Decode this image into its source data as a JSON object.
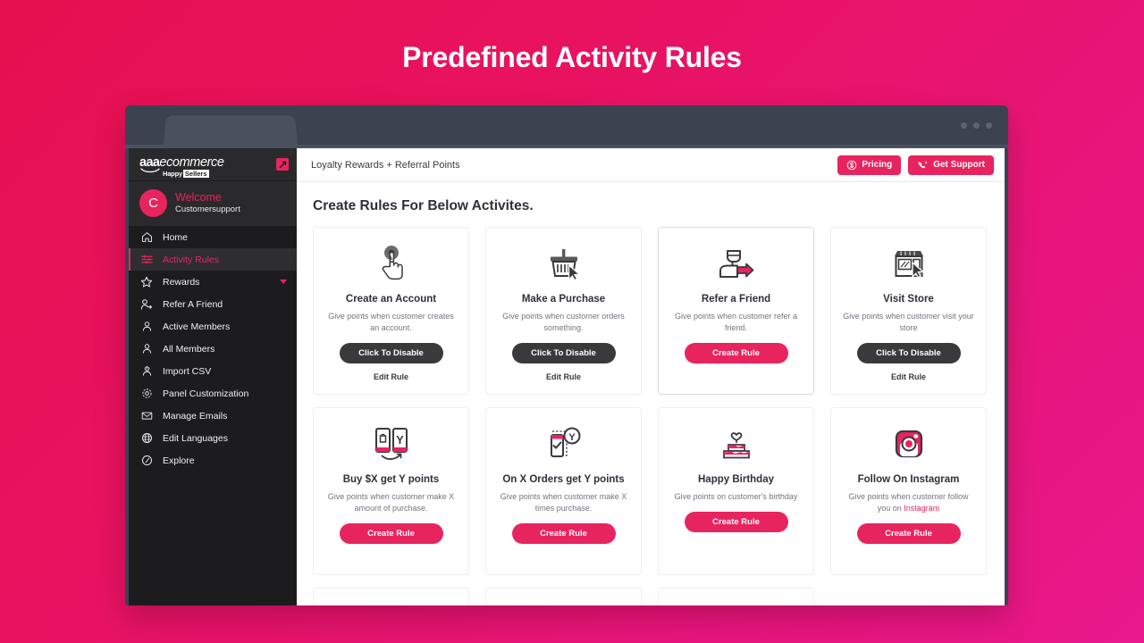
{
  "page": {
    "title": "Predefined Activity Rules",
    "background_start": "#e6104f",
    "background_end": "#e9188c",
    "accent": "#e8245f"
  },
  "sidebar": {
    "brand": {
      "aaa": "aaa",
      "ecommerce": "ecommerce",
      "happy": "Happy",
      "sellers": "Sellers",
      "collapse_icon": "expand-arrow-icon"
    },
    "welcome": {
      "avatar_letter": "C",
      "title": "Welcome",
      "username": "Customersupport"
    },
    "items": [
      {
        "label": "Home",
        "icon": "home-icon",
        "active": false,
        "caret": false
      },
      {
        "label": "Activity Rules",
        "icon": "sliders-icon",
        "active": true,
        "caret": false
      },
      {
        "label": "Rewards",
        "icon": "star-icon",
        "active": false,
        "caret": true
      },
      {
        "label": "Refer A Friend",
        "icon": "user-arrow-icon",
        "active": false,
        "caret": false
      },
      {
        "label": "Active Members",
        "icon": "user-icon",
        "active": false,
        "caret": false
      },
      {
        "label": "All Members",
        "icon": "user-icon",
        "active": false,
        "caret": false
      },
      {
        "label": "Import CSV",
        "icon": "user-import-icon",
        "active": false,
        "caret": false
      },
      {
        "label": "Panel Customization",
        "icon": "gear-icon",
        "active": false,
        "caret": false
      },
      {
        "label": "Manage Emails",
        "icon": "envelope-icon",
        "active": false,
        "caret": false
      },
      {
        "label": "Edit Languages",
        "icon": "globe-icon",
        "active": false,
        "caret": false
      },
      {
        "label": "Explore",
        "icon": "compass-icon",
        "active": false,
        "caret": false
      }
    ]
  },
  "topbar": {
    "title": "Loyalty Rewards + Referral Points",
    "pricing_label": "Pricing",
    "pricing_icon": "dollar-circle-icon",
    "support_label": "Get Support",
    "support_icon": "phone-ring-icon"
  },
  "main": {
    "heading": "Create Rules For Below Activites.",
    "cards": [
      {
        "title": "Create an Account",
        "description": "Give points when customer creates an account.",
        "button_label": "Click To Disable",
        "button_style": "dark",
        "edit_label": "Edit Rule",
        "icon": "click-hand-icon",
        "hovered": false
      },
      {
        "title": "Make a Purchase",
        "description": "Give points when customer orders something.",
        "button_label": "Click To Disable",
        "button_style": "dark",
        "edit_label": "Edit Rule",
        "icon": "shopping-basket-cursor-icon",
        "hovered": false
      },
      {
        "title": "Refer a Friend",
        "description": "Give points when customer refer a friend.",
        "button_label": "Create Rule",
        "button_style": "pink",
        "edit_label": "",
        "icon": "person-arrow-icon",
        "hovered": true
      },
      {
        "title": "Visit Store",
        "description": "Give points when customer visit your store",
        "button_label": "Click To Disable",
        "button_style": "dark",
        "edit_label": "Edit Rule",
        "icon": "storefront-cursor-icon",
        "hovered": false
      },
      {
        "title": "Buy $X get Y points",
        "description": "Give points when customer make X amount of purchase.",
        "button_label": "Create Rule",
        "button_style": "pink",
        "edit_label": "",
        "icon": "two-phones-icon",
        "hovered": false
      },
      {
        "title": "On X Orders get Y points",
        "description": "Give points when customer make X times purchase.",
        "button_label": "Create Rule",
        "button_style": "pink",
        "edit_label": "",
        "icon": "phone-check-y-icon",
        "hovered": false
      },
      {
        "title": "Happy Birthday",
        "description": "Give points on customer's birthday",
        "button_label": "Create Rule",
        "button_style": "pink",
        "edit_label": "",
        "icon": "birthday-cake-icon",
        "hovered": false
      },
      {
        "title": "Follow On Instagram",
        "description_before": "Give points when customer follow you on ",
        "description_link": "Instagram",
        "description": "Give points when customer follow you on Instagram",
        "button_label": "Create Rule",
        "button_style": "pink",
        "edit_label": "",
        "icon": "instagram-icon",
        "hovered": false
      }
    ]
  }
}
